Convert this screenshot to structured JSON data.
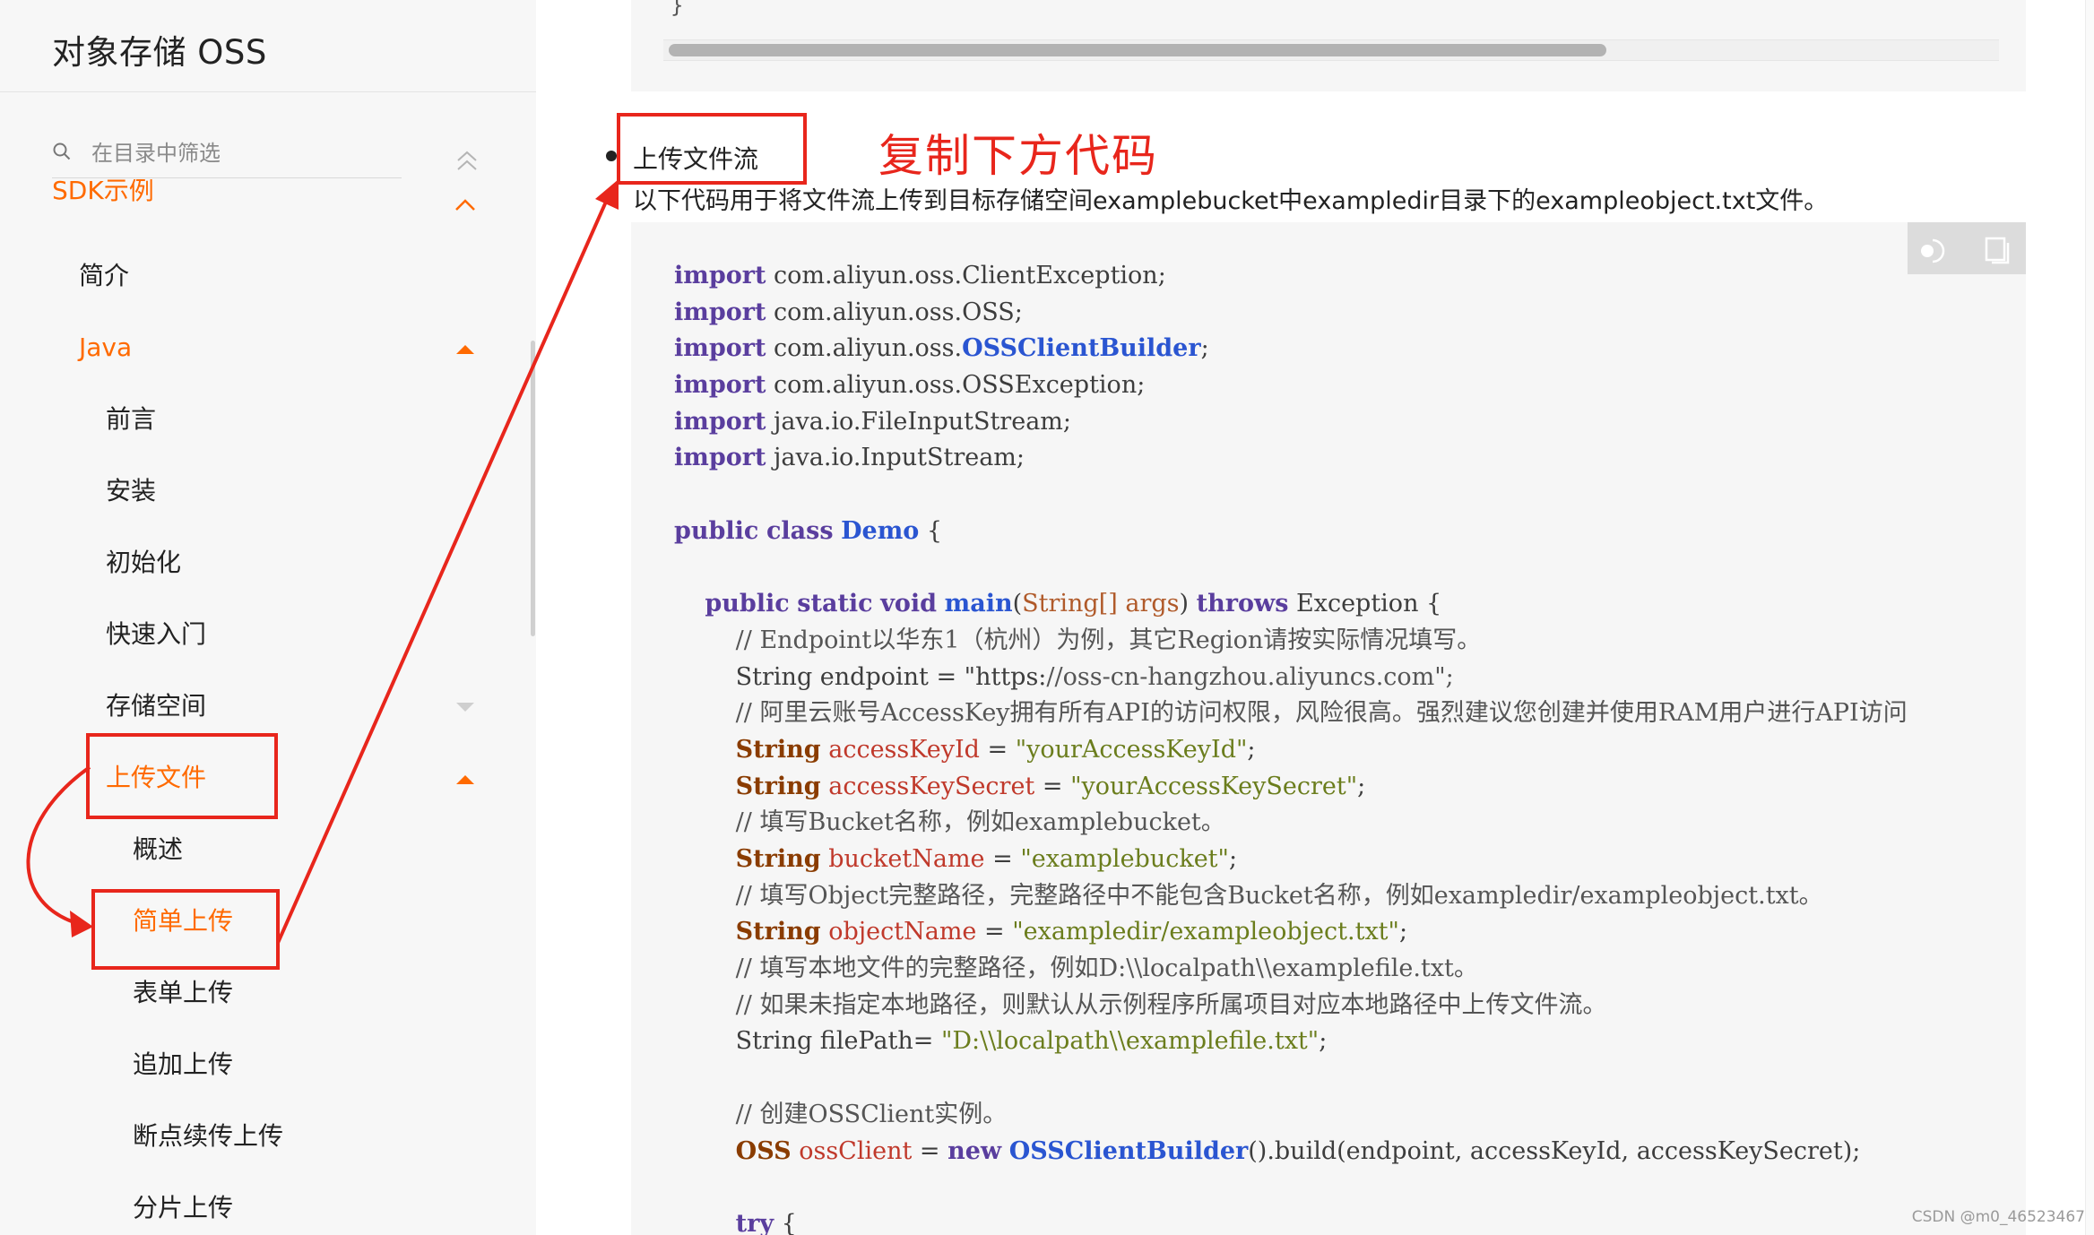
{
  "sidebar": {
    "title": "对象存储 OSS",
    "filter_placeholder": "在目录中筛选",
    "items": [
      {
        "label": "SDK示例"
      },
      {
        "label": "简介"
      },
      {
        "label": "Java"
      },
      {
        "label": "前言"
      },
      {
        "label": "安装"
      },
      {
        "label": "初始化"
      },
      {
        "label": "快速入门"
      },
      {
        "label": "存储空间"
      },
      {
        "label": "上传文件"
      },
      {
        "label": "概述"
      },
      {
        "label": "简单上传"
      },
      {
        "label": "表单上传"
      },
      {
        "label": "追加上传"
      },
      {
        "label": "断点续传上传"
      },
      {
        "label": "分片上传"
      }
    ]
  },
  "main": {
    "prev_code_tail": "}",
    "section_heading": "上传文件流",
    "annotation": "复制下方代码",
    "description": "以下代码用于将文件流上传到目标存储空间examplebucket中exampledir目录下的exampleobject.txt文件。",
    "code_lines": [
      "import com.aliyun.oss.ClientException;",
      "import com.aliyun.oss.OSS;",
      "import com.aliyun.oss.OSSClientBuilder;",
      "import com.aliyun.oss.OSSException;",
      "import java.io.FileInputStream;",
      "import java.io.InputStream;",
      "",
      "public class Demo {",
      "",
      "    public static void main(String[] args) throws Exception {",
      "        // Endpoint以华东1（杭州）为例，其它Region请按实际情况填写。",
      "        String endpoint = \"https://oss-cn-hangzhou.aliyuncs.com\";",
      "        // 阿里云账号AccessKey拥有所有API的访问权限，风险很高。强烈建议您创建并使用RAM用户进行API访问",
      "        String accessKeyId = \"yourAccessKeyId\";",
      "        String accessKeySecret = \"yourAccessKeySecret\";",
      "        // 填写Bucket名称，例如examplebucket。",
      "        String bucketName = \"examplebucket\";",
      "        // 填写Object完整路径，完整路径中不能包含Bucket名称，例如exampledir/exampleobject.txt。",
      "        String objectName = \"exampledir/exampleobject.txt\";",
      "        // 填写本地文件的完整路径，例如D:\\\\localpath\\\\examplefile.txt。",
      "        // 如果未指定本地路径，则默认从示例程序所属项目对应本地路径中上传文件流。",
      "        String filePath= \"D:\\\\localpath\\\\examplefile.txt\";",
      "",
      "        // 创建OSSClient实例。",
      "        OSS ossClient = new OSSClientBuilder().build(endpoint, accessKeyId, accessKeySecret);",
      "",
      "        try {"
    ]
  },
  "watermark": "CSDN @m0_46523467",
  "colors": {
    "accent_orange": "#ff6a00",
    "annotation_red": "#e8261c",
    "sidebar_bg": "#f7f7f7",
    "code_bg": "#f6f6f6"
  },
  "icons": [
    "search-icon",
    "double-chevron-up-icon",
    "chevron-up-icon",
    "caret-up-icon",
    "caret-down-icon",
    "theme-toggle-icon",
    "copy-icon"
  ]
}
